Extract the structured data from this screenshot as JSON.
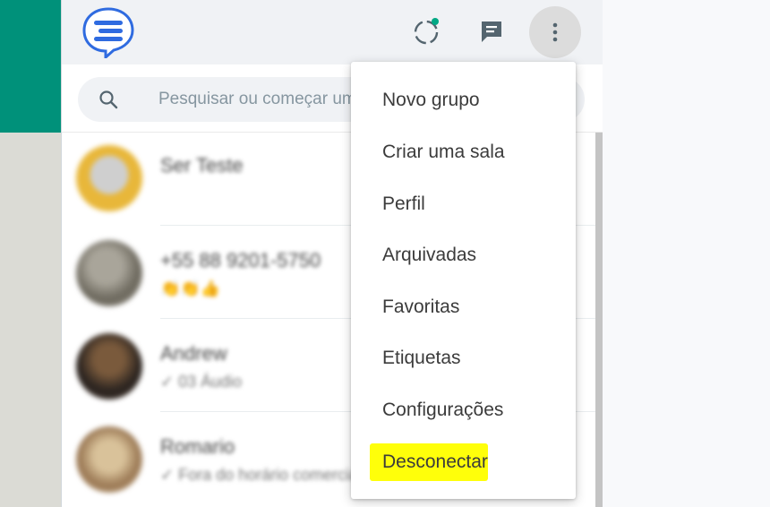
{
  "colors": {
    "teal_banner": "#00917a",
    "logo_blue": "#2f6be0",
    "status_dot": "#00a884",
    "highlight_yellow": "#ffff0a"
  },
  "header": {
    "logo_icon": "chat-bubble-logo",
    "status_icon": "status-ring-icon",
    "new_chat_icon": "new-chat-icon",
    "menu_icon": "kebab-menu-icon"
  },
  "search": {
    "placeholder": "Pesquisar ou começar uma nova conversa",
    "icon": "search-icon"
  },
  "chats": [
    {
      "name": "Ser Teste",
      "preview": ""
    },
    {
      "name": "+55 88 9201-5750",
      "preview": "👏👏👍"
    },
    {
      "name": "Andrew",
      "preview": "✓ 03 Áudio"
    },
    {
      "name": "Romario",
      "preview": "✓ Fora do horário comercial"
    }
  ],
  "menu": {
    "items": [
      "Novo grupo",
      "Criar uma sala",
      "Perfil",
      "Arquivadas",
      "Favoritas",
      "Etiquetas",
      "Configurações",
      "Desconectar"
    ],
    "highlighted": "Desconectar"
  }
}
